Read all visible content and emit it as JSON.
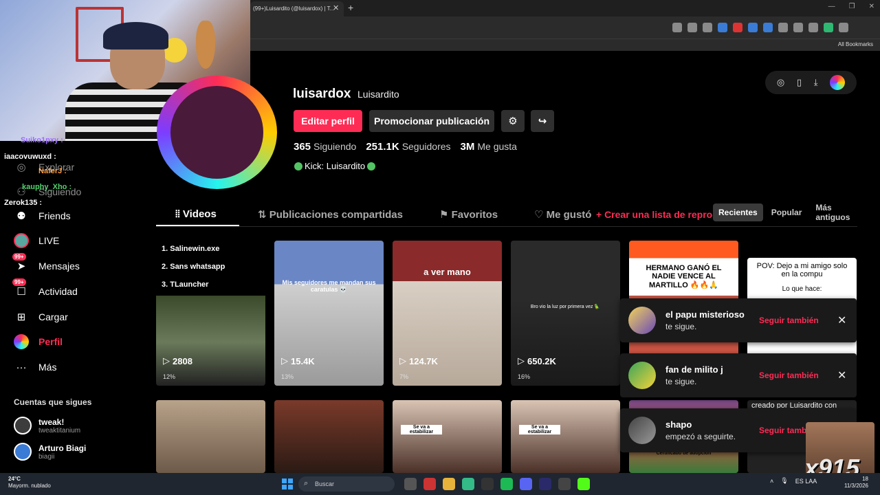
{
  "browser": {
    "tab_title": "(99+)Luisardito (@luisardox) | T...",
    "tab_close": "✕",
    "tab_new": "+",
    "bookmarks_all": "All Bookmarks"
  },
  "chat": {
    "lines": [
      "Suiko1pxy :",
      "iaacovuwuxd :",
      "NaferJ :",
      "kauphy_Xho :",
      "Zerok135 :"
    ]
  },
  "sidebar": {
    "items": [
      {
        "label": "Explorar",
        "icon": "compass-icon"
      },
      {
        "label": "Siguiendo",
        "icon": "users-icon"
      },
      {
        "label": "Friends",
        "icon": "friends-icon"
      },
      {
        "label": "LIVE",
        "icon": "live-icon"
      },
      {
        "label": "Mensajes",
        "icon": "message-icon",
        "badge": "99+"
      },
      {
        "label": "Actividad",
        "icon": "inbox-icon",
        "badge": "99+"
      },
      {
        "label": "Cargar",
        "icon": "plus-square-icon"
      },
      {
        "label": "Perfil",
        "icon": "profile-avatar"
      },
      {
        "label": "Más",
        "icon": "more-icon"
      }
    ],
    "following_title": "Cuentas que sigues",
    "following": [
      {
        "name": "tweak!",
        "handle": "tweaktitanium"
      },
      {
        "name": "Arturo Biagi",
        "handle": "biagii"
      }
    ]
  },
  "profile": {
    "username": "luisardox",
    "nickname": "Luisardito",
    "edit_label": "Editar perfil",
    "promote_label": "Promocionar publicación",
    "stats": [
      {
        "value": "365",
        "label": "Siguiendo"
      },
      {
        "value": "251.1K",
        "label": "Seguidores"
      },
      {
        "value": "3M",
        "label": "Me gusta"
      }
    ],
    "bio": "Kick: Luisardito"
  },
  "tabs": {
    "videos": "Videos",
    "shared": "Publicaciones compartidas",
    "favorites": "Favoritos",
    "liked": "Me gustó",
    "create_list": "+ Crear una lista de reproducción",
    "sort": [
      "Recientes",
      "Popular",
      "Más antiguos"
    ]
  },
  "videos": [
    {
      "lines": [
        "1. Salinewin.exe",
        "2. Sans whatsapp",
        "3. TLauncher"
      ],
      "views": "2808",
      "pct": "12%"
    },
    {
      "caption": "Mis seguidores me mandan sus caratulas 💀",
      "views": "15.4K",
      "pct": "13%"
    },
    {
      "caption": "a ver mano",
      "views": "124.7K",
      "pct": "7%"
    },
    {
      "caption": "Bro vio la luz por primera vez 🦜",
      "views": "650.2K",
      "pct": "16%"
    },
    {
      "caption": "HERMANO GANÓ EL NADIE VENCE AL MARTILLO 🔥🔥🙏"
    },
    {
      "caption": "POV: Dejo a mi amigo solo en la compu",
      "sub": "Lo que hace:"
    }
  ],
  "videos_row2": [
    {
      "caption": ""
    },
    {
      "caption": ""
    },
    {
      "caption": "Se va a estabilizar"
    },
    {
      "caption": "Se va a estabilizar"
    },
    {
      "caption": "Certificado de adopción"
    },
    {
      "caption": "creado por Luisardito con"
    }
  ],
  "notifications": [
    {
      "name": "el papu misterioso",
      "action": "te sigue.",
      "follow": "Seguir también",
      "close": "✕"
    },
    {
      "name": "fan de milito j",
      "action": "te sigue.",
      "follow": "Seguir también",
      "close": "✕"
    },
    {
      "name": "shapo",
      "action": "empezó a seguirte.",
      "follow": "Seguir también"
    }
  ],
  "sticker_text": "x915",
  "taskbar": {
    "temp": "24°C",
    "weather": "Mayorm. nublado",
    "search": "Buscar",
    "lang": "ES LAA",
    "time": "18",
    "date": "11/3/2026"
  },
  "colors": {
    "accent": "#fe2c55",
    "background": "#000000"
  }
}
